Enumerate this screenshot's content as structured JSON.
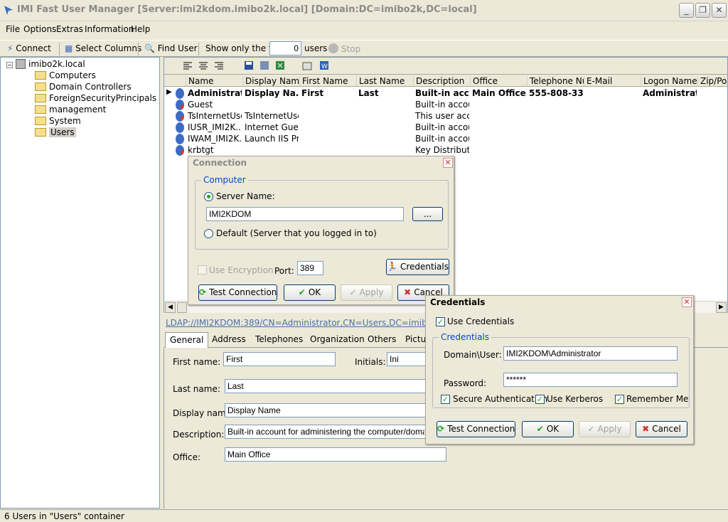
{
  "window": {
    "title": "IMI Fast User Manager  [Server:imi2kdom.imibo2k.local] [Domain:DC=imibo2k,DC=local]"
  },
  "menu": [
    "File",
    "Options",
    "Extras",
    "Information",
    "Help"
  ],
  "toolbar": {
    "connect": "Connect",
    "select_columns": "Select Columns",
    "find_user": "Find User",
    "show_first_label": "Show only the first",
    "show_first_value": "0",
    "users_label": "users",
    "stop": "Stop"
  },
  "tree": {
    "root": "imibo2k.local",
    "items": [
      "Computers",
      "Domain Controllers",
      "ForeignSecurityPrincipals",
      "management",
      "System",
      "Users"
    ]
  },
  "grid": {
    "columns": [
      "Name",
      "Display Name",
      "First Name",
      "Last Name",
      "Description",
      "Office",
      "Telephone Nu...",
      "E-Mail",
      "Logon Name",
      "Zip/Pos"
    ],
    "rows": [
      {
        "name": "Administrator",
        "display": "Display Na...",
        "first": "First",
        "last": "Last",
        "desc": "Built-in acc...",
        "office": "Main Office",
        "tel": "555-808-333",
        "logon": "Administrat..."
      },
      {
        "name": "Guest",
        "display": "",
        "first": "",
        "last": "",
        "desc": "Built-in accou...",
        "office": "",
        "tel": "",
        "logon": ""
      },
      {
        "name": "TsInternetUser",
        "display": "TsInternetUser",
        "first": "",
        "last": "",
        "desc": "This user acc...",
        "office": "",
        "tel": "",
        "logon": ""
      },
      {
        "name": "IUSR_IMI2K...",
        "display": "Internet Guest...",
        "first": "",
        "last": "",
        "desc": "Built-in accou...",
        "office": "",
        "tel": "",
        "logon": ""
      },
      {
        "name": "IWAM_IMI2K...",
        "display": "Launch IIS Pr...",
        "first": "",
        "last": "",
        "desc": "Built-in accou...",
        "office": "",
        "tel": "",
        "logon": ""
      },
      {
        "name": "krbtgt",
        "display": "",
        "first": "",
        "last": "",
        "desc": "Key Distributio...",
        "office": "",
        "tel": "",
        "logon": ""
      }
    ]
  },
  "detail": {
    "ldap": "LDAP://IMI2KDOM:389/CN=Administrator,CN=Users,DC=imibo2k,DC=local",
    "tabs": [
      "General",
      "Address",
      "Telephones",
      "Organization",
      "Others",
      "Pictur"
    ],
    "first_name_label": "First name:",
    "first_name": "First",
    "initials_label": "Initials:",
    "initials": "Ini",
    "last_name_label": "Last name:",
    "last_name": "Last",
    "display_name_label": "Display name:",
    "display_name": "Display Name",
    "description_label": "Description:",
    "description": "Built-in account for administering the computer/domain",
    "office_label": "Office:",
    "office": "Main Office"
  },
  "status": "6 Users in \"Users\" container",
  "connection": {
    "title": "Connection",
    "group": "Computer",
    "server_name_label": "Server Name:",
    "server_name": "IMI2KDOM",
    "browse": "...",
    "default_label": "Default (Server that you logged in to)",
    "encryption_label": "Use Encryption",
    "port_label": "Port:",
    "port": "389",
    "credentials_button": "Credentials",
    "test": "Test Connection",
    "ok": "OK",
    "apply": "Apply",
    "cancel": "Cancel"
  },
  "credentials": {
    "title": "Credentials",
    "use_credentials": "Use Credentials",
    "group": "Credentials",
    "domain_user_label": "Domain\\User:",
    "domain_user": "IMI2KDOM\\Administrator",
    "password_label": "Password:",
    "password": "******",
    "secure_auth": "Secure Authentication",
    "kerberos": "Use Kerberos",
    "remember": "Remember Me",
    "test": "Test Connection",
    "ok": "OK",
    "apply": "Apply",
    "cancel": "Cancel"
  }
}
